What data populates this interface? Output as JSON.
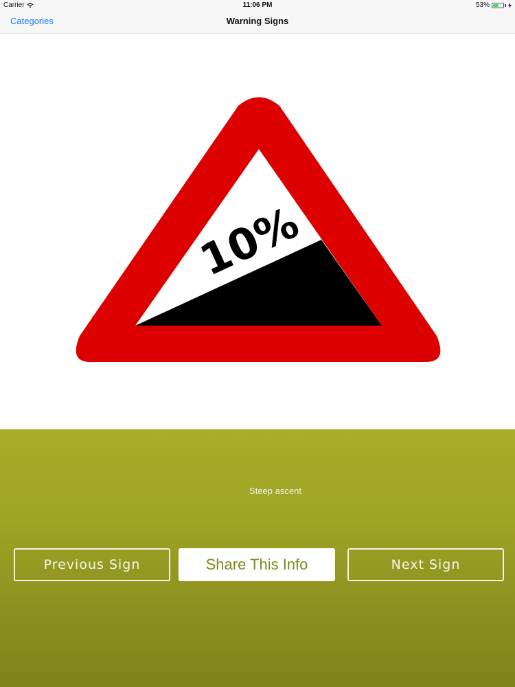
{
  "status_bar": {
    "carrier": "Carrier",
    "time": "11:06 PM",
    "battery_percent": "53%",
    "battery_level": 0.53,
    "wifi_icon": "wifi-icon",
    "charging_icon": "charging-bolt-icon"
  },
  "nav": {
    "back_label": "Categories",
    "title": "Warning Signs"
  },
  "sign": {
    "text": "10%",
    "colors": {
      "border": "#dc0000",
      "fill": "#ffffff",
      "slope": "#000000"
    }
  },
  "info": {
    "sign_name": "Steep ascent"
  },
  "buttons": {
    "previous": "Previous Sign",
    "share": "Share This Info",
    "next": "Next Sign"
  },
  "colors": {
    "accent": "#1a7cf0",
    "panel": "#9ea424",
    "share_text": "#7a8a1c"
  }
}
